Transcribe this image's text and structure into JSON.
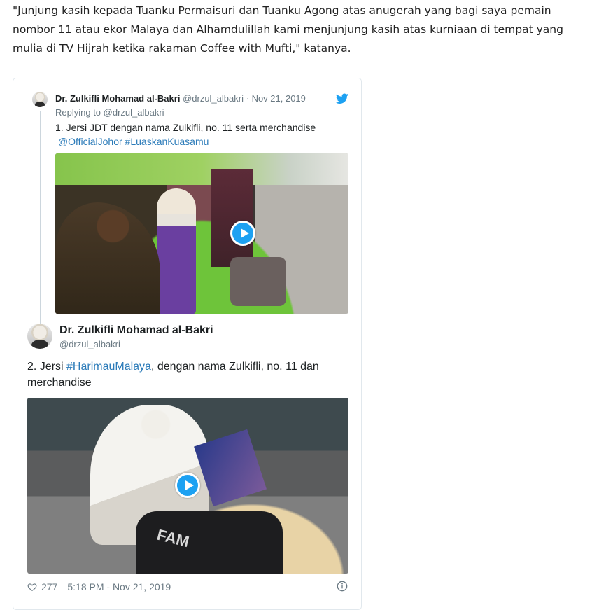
{
  "article": {
    "quote": "\"Junjung kasih kepada Tuanku Permaisuri dan Tuanku Agong atas anugerah yang bagi saya pemain nombor 11 atau ekor Malaya dan Alhamdulillah kami menjunjung kasih atas kurniaan di tempat yang mulia di TV Hijrah ketika rakaman Coffee with Mufti,\" katanya."
  },
  "parent_tweet": {
    "author_name": "Dr. Zulkifli Mohamad al-Bakri",
    "handle": "@drzul_albakri",
    "separator": "·",
    "date": "Nov 21, 2019",
    "replying_to": "Replying to @drzul_albakri",
    "text": "1. Jersi JDT dengan nama Zulkifli, no. 11 serta merchandise",
    "links": [
      "@OfficialJohor",
      "#LuaskanKuasamu"
    ]
  },
  "main_tweet": {
    "author_name": "Dr. Zulkifli Mohamad al-Bakri",
    "handle": "@drzul_albakri",
    "text_before": "2. Jersi ",
    "hashtag": "#HarimauMalaya",
    "text_after": ", dengan nama Zulkifli, no. 11 dan merchandise",
    "video_overlay_text": "FAM",
    "likes": "277",
    "timestamp": "5:18 PM - Nov 21, 2019"
  },
  "colors": {
    "twitter_blue": "#1da1f2",
    "link": "#2b7bb9",
    "muted": "#697882"
  }
}
